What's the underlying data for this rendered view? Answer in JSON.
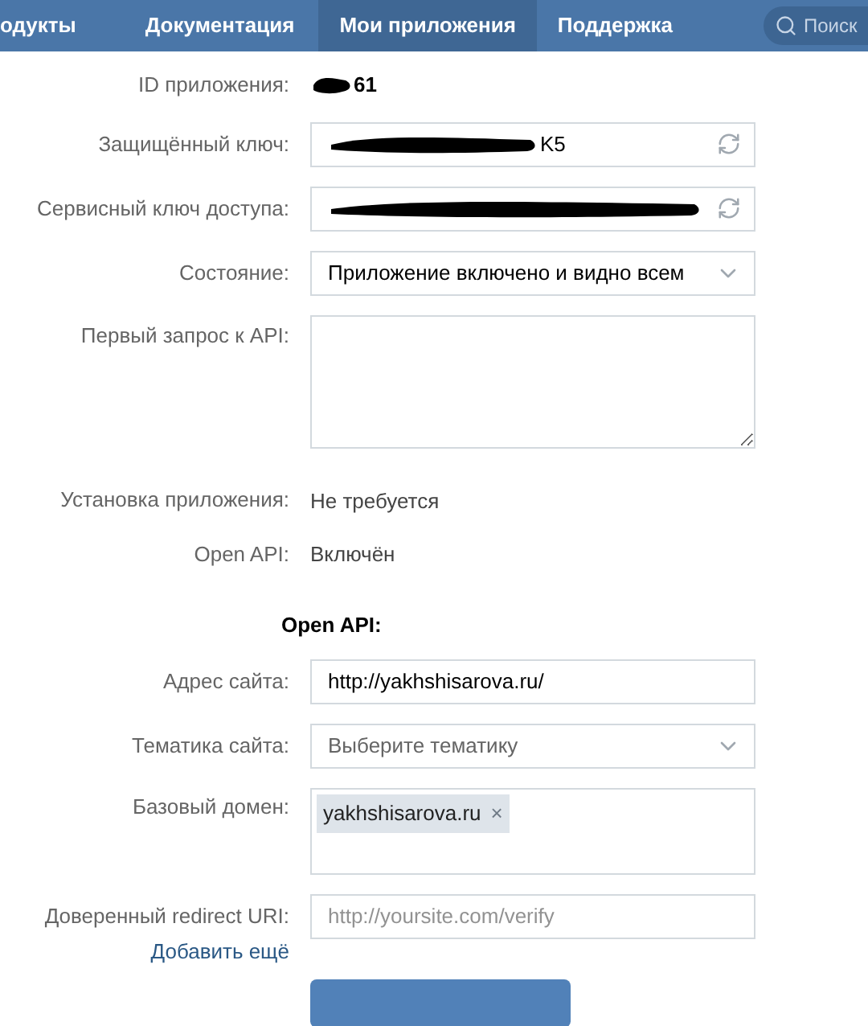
{
  "nav": {
    "tabs": [
      {
        "label": "одукты",
        "selected": false
      },
      {
        "label": "Документация",
        "selected": false
      },
      {
        "label": "Мои приложения",
        "selected": true
      },
      {
        "label": "Поддержка",
        "selected": false
      }
    ],
    "search": {
      "placeholder": "Поиск"
    }
  },
  "form": {
    "rows": [
      {
        "kind": "text",
        "label": "ID приложения:",
        "value": "61",
        "redacted": true,
        "bold": true
      },
      {
        "kind": "input",
        "label": "Защищённый ключ:",
        "value": "K5",
        "redacted": true,
        "refresh": true
      },
      {
        "kind": "input",
        "label": "Сервисный ключ доступа:",
        "redacted": true,
        "refresh": true
      },
      {
        "kind": "select",
        "label": "Состояние:",
        "value": "Приложение включено и видно всем"
      },
      {
        "kind": "textarea",
        "label": "Первый запрос к API:"
      },
      {
        "kind": "text",
        "label": "Установка приложения:",
        "value": "Не требуется"
      },
      {
        "kind": "text",
        "label": "Open API:",
        "value": "Включён"
      },
      {
        "kind": "heading",
        "label": "Open API:"
      },
      {
        "kind": "input",
        "label": "Адрес сайта:",
        "value": "http://yakhshisarova.ru/"
      },
      {
        "kind": "select",
        "label": "Тематика сайта:",
        "placeholder": "Выберите тематику"
      },
      {
        "kind": "tags",
        "label": "Базовый домен:",
        "tags": [
          {
            "label": "yakhshisarova.ru",
            "remove": "×"
          }
        ]
      },
      {
        "kind": "input",
        "label": "Доверенный redirect URI:",
        "placeholder": "http://yoursite.com/verify",
        "link": "Добавить ещё"
      }
    ]
  }
}
